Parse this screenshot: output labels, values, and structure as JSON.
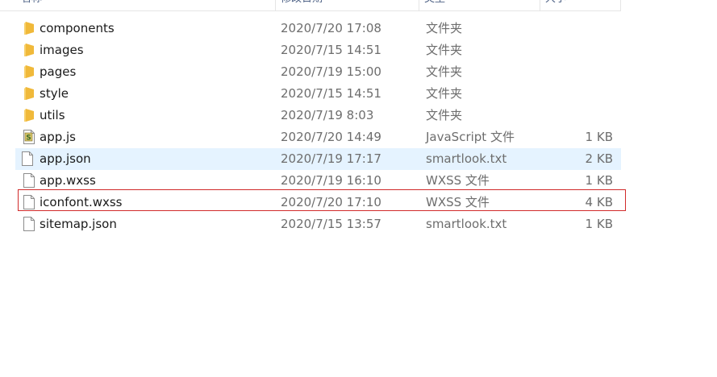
{
  "columns": {
    "name": "名称",
    "date": "修改日期",
    "type": "类型",
    "size": "大小"
  },
  "files": [
    {
      "name": "components",
      "date": "2020/7/20 17:08",
      "type": "文件夹",
      "size": "",
      "icon": "folder-icon"
    },
    {
      "name": "images",
      "date": "2020/7/15 14:51",
      "type": "文件夹",
      "size": "",
      "icon": "folder-icon"
    },
    {
      "name": "pages",
      "date": "2020/7/19 15:00",
      "type": "文件夹",
      "size": "",
      "icon": "folder-icon"
    },
    {
      "name": "style",
      "date": "2020/7/15 14:51",
      "type": "文件夹",
      "size": "",
      "icon": "folder-icon"
    },
    {
      "name": "utils",
      "date": "2020/7/19 8:03",
      "type": "文件夹",
      "size": "",
      "icon": "folder-icon"
    },
    {
      "name": "app.js",
      "date": "2020/7/20 14:49",
      "type": "JavaScript 文件",
      "size": "1 KB",
      "icon": "javascript-file-icon"
    },
    {
      "name": "app.json",
      "date": "2020/7/19 17:17",
      "type": "smartlook.txt",
      "size": "2 KB",
      "icon": "file-icon"
    },
    {
      "name": "app.wxss",
      "date": "2020/7/19 16:10",
      "type": "WXSS 文件",
      "size": "1 KB",
      "icon": "file-icon"
    },
    {
      "name": "iconfont.wxss",
      "date": "2020/7/20 17:10",
      "type": "WXSS 文件",
      "size": "4 KB",
      "icon": "file-icon"
    },
    {
      "name": "sitemap.json",
      "date": "2020/7/15 13:57",
      "type": "smartlook.txt",
      "size": "1 KB",
      "icon": "file-icon"
    }
  ],
  "colors": {
    "folder": "#f5c542",
    "hover_row": "#e5f3ff",
    "highlight_border": "#d12b2b"
  }
}
